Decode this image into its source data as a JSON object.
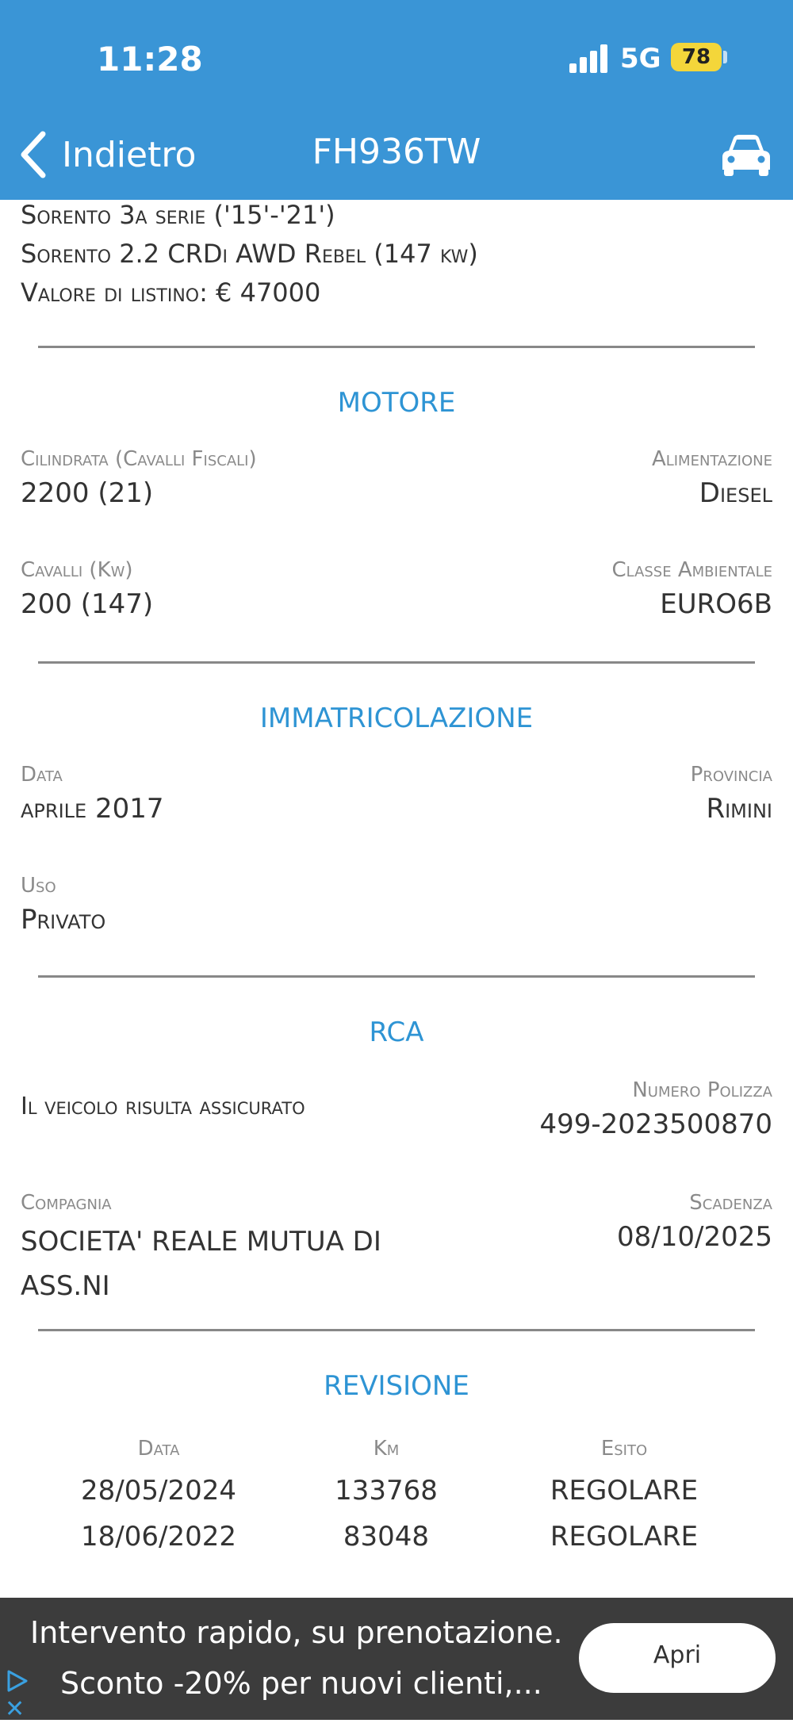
{
  "status_bar": {
    "time": "11:28",
    "network": "5G",
    "battery": "78"
  },
  "nav": {
    "back_label": "Indietro",
    "title": "FH936TW",
    "car_icon": "car-icon"
  },
  "vehicle": {
    "line1": "Sorento 3a serie ('15'-'21')",
    "line2": "Sorento 2.2 CRDi AWD Rebel (147 kw)",
    "line3": "Valore di listino: € 47000"
  },
  "motore": {
    "title": "MOTORE",
    "cilindrata_label": "Cilindrata (Cavalli Fiscali)",
    "cilindrata_value": "2200 (21)",
    "alimentazione_label": "Alimentazione",
    "alimentazione_value": "Diesel",
    "cavalli_label": "Cavalli (Kw)",
    "cavalli_value": "200 (147)",
    "classe_label": "Classe Ambientale",
    "classe_value": "EURO6B"
  },
  "immatricolazione": {
    "title": "IMMATRICOLAZIONE",
    "data_label": "Data",
    "data_value": "aprile 2017",
    "provincia_label": "Provincia",
    "provincia_value": "Rimini",
    "uso_label": "Uso",
    "uso_value": "Privato"
  },
  "rca": {
    "title": "RCA",
    "status": "Il veicolo risulta assicurato",
    "polizza_label": "Numero Polizza",
    "polizza_value": "499-2023500870",
    "compagnia_label": "Compagnia",
    "compagnia_value": "SOCIETA' REALE MUTUA DI ASS.NI",
    "scadenza_label": "Scadenza",
    "scadenza_value": "08/10/2025"
  },
  "revisione": {
    "title": "REVISIONE",
    "headers": [
      "Data",
      "Km",
      "Esito"
    ],
    "rows": [
      [
        "28/05/2024",
        "133768",
        "REGOLARE"
      ],
      [
        "18/06/2022",
        "83048",
        "REGOLARE"
      ]
    ]
  },
  "ad": {
    "line1": "Intervento rapido, su prenotazione.",
    "line2": "Sconto -20% per nuovi clienti,...",
    "button": "Apri"
  },
  "colors": {
    "header": "#3a95d6",
    "accent": "#2e94d4",
    "ad_bg": "#3c3c3c"
  }
}
